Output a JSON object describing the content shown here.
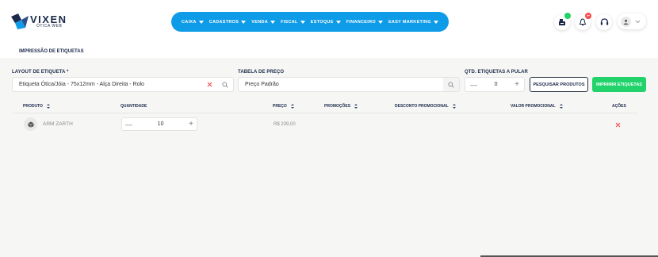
{
  "brand": {
    "name": "VIXEN",
    "subtitle": "ÓTICA WEB",
    "logo_color": "#1b2a4a",
    "accent": "#0e9be8"
  },
  "nav": {
    "items": [
      {
        "label": "CAIXA"
      },
      {
        "label": "CADASTROS"
      },
      {
        "label": "VENDA"
      },
      {
        "label": "FISCAL"
      },
      {
        "label": "ESTOQUE"
      },
      {
        "label": "FINANCEIRO"
      },
      {
        "label": "EASY MARKETING"
      }
    ]
  },
  "header_icons": {
    "cash_badge_color": "#22d36b",
    "bell_badge": "9+",
    "bell_badge_color": "#f04848"
  },
  "tab": {
    "label": "IMPRESSÃO DE ETIQUETAS"
  },
  "form": {
    "layout_label": "LAYOUT DE ETIQUETA *",
    "layout_value": "Etiqueta Ótica/Jóia - 75x12mm - Alça Direita - Rolo",
    "price_table_label": "TABELA DE PREÇO",
    "price_table_value": "Preço Padrão",
    "skip_label": "QTD. ETIQUETAS A PULAR",
    "skip_value": "0",
    "search_products": "PESQUISAR PRODUTOS",
    "print_labels": "IMPRIMIR ETIQUETAS",
    "print_color": "#22d36b"
  },
  "table": {
    "headers": {
      "produto": "PRODUTO",
      "quantidade": "QUANTIDADE",
      "preco": "PREÇO",
      "promocoes": "PROMOÇÕES",
      "desconto": "DESCONTO PROMOCIONAL",
      "valor_promo": "VALOR PROMOCIONAL",
      "acoes": "AÇÕES"
    },
    "rows": [
      {
        "product": "ARM ZARTH",
        "quantity": "10",
        "price": "R$ 239,00"
      }
    ],
    "delete_color": "#f04848"
  }
}
